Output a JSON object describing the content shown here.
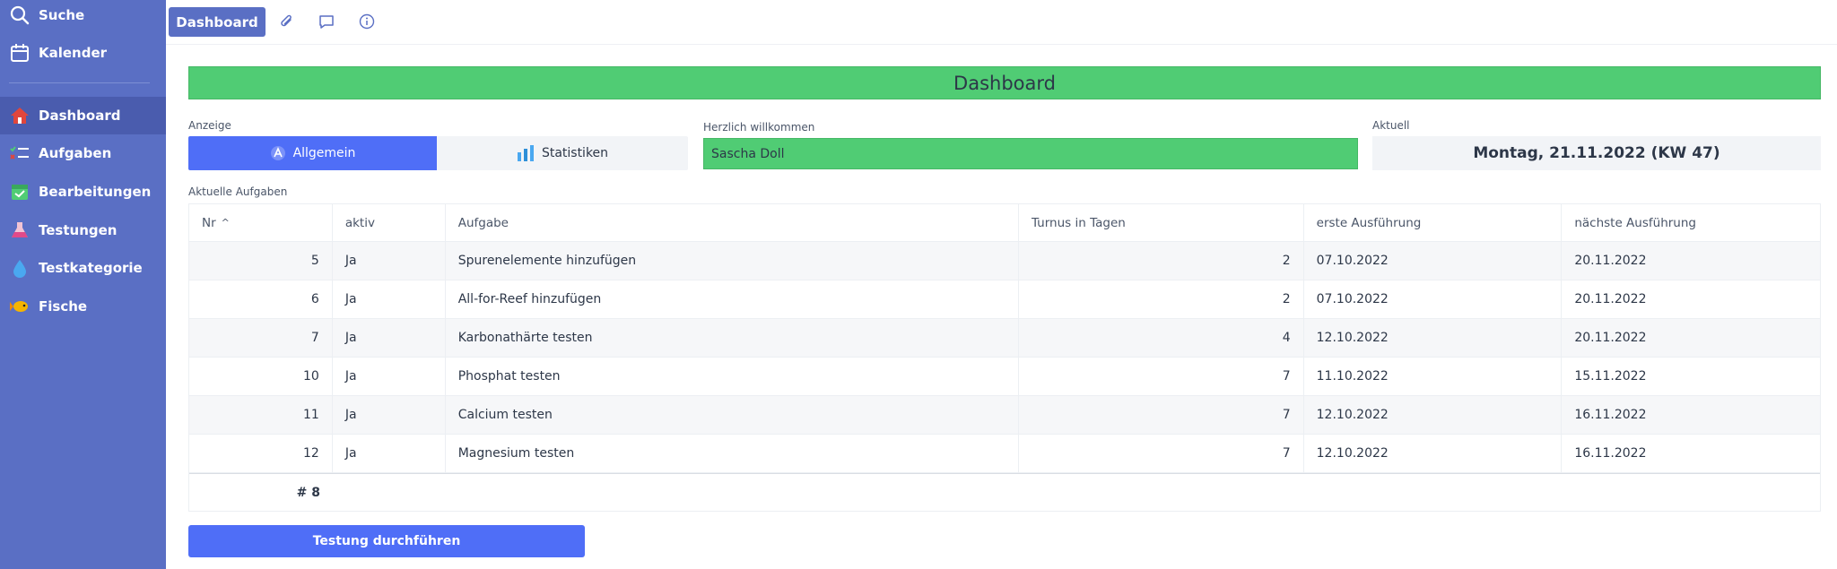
{
  "sidebar": {
    "items": [
      {
        "label": "Suche",
        "icon": "search-icon"
      },
      {
        "label": "Kalender",
        "icon": "calendar-icon"
      },
      {
        "label": "Dashboard",
        "icon": "home-icon",
        "active": true
      },
      {
        "label": "Aufgaben",
        "icon": "task-list-icon"
      },
      {
        "label": "Bearbeitungen",
        "icon": "calendar-check-icon"
      },
      {
        "label": "Testungen",
        "icon": "flask-icon"
      },
      {
        "label": "Testkategorie",
        "icon": "water-drop-icon"
      },
      {
        "label": "Fische",
        "icon": "fish-icon"
      }
    ]
  },
  "toolbar": {
    "tab_label": "Dashboard",
    "icons": [
      "attachment-icon",
      "comment-icon",
      "info-icon"
    ]
  },
  "banner": {
    "title": "Dashboard"
  },
  "view": {
    "label": "Anzeige",
    "options": [
      {
        "label": "Allgemein",
        "icon": "app-icon",
        "selected": true
      },
      {
        "label": "Statistiken",
        "icon": "bar-chart-icon",
        "selected": false
      }
    ]
  },
  "welcome": {
    "label": "Herzlich willkommen",
    "value": "Sascha Doll"
  },
  "current": {
    "label": "Aktuell",
    "value": "Montag, 21.11.2022 (KW 47)"
  },
  "tasks": {
    "label": "Aktuelle Aufgaben",
    "columns": [
      "Nr",
      "aktiv",
      "Aufgabe",
      "Turnus in Tagen",
      "erste Ausführung",
      "nächste Ausführung"
    ],
    "sort_indicator": "^",
    "rows": [
      [
        "5",
        "Ja",
        "Spurenelemente hinzufügen",
        "2",
        "07.10.2022",
        "20.11.2022"
      ],
      [
        "6",
        "Ja",
        "All-for-Reef hinzufügen",
        "2",
        "07.10.2022",
        "20.11.2022"
      ],
      [
        "7",
        "Ja",
        "Karbonathärte testen",
        "4",
        "12.10.2022",
        "20.11.2022"
      ],
      [
        "10",
        "Ja",
        "Phosphat testen",
        "7",
        "11.10.2022",
        "15.11.2022"
      ],
      [
        "11",
        "Ja",
        "Calcium testen",
        "7",
        "12.10.2022",
        "16.11.2022"
      ],
      [
        "12",
        "Ja",
        "Magnesium testen",
        "7",
        "12.10.2022",
        "16.11.2022"
      ]
    ],
    "footer_count": "# 8"
  },
  "actions": {
    "primary_label": "Testung durchführen"
  },
  "colors": {
    "sidebar": "#5a6fc4",
    "accent": "#4f6ef7",
    "success": "#50cc74"
  }
}
